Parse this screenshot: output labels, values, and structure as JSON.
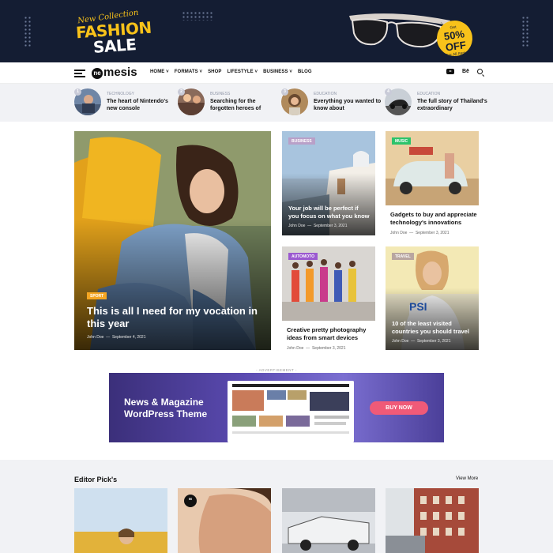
{
  "promo_banner": {
    "line1": "New Collection",
    "line2": "FASHION",
    "line3": "SALE",
    "tag_top": "Get",
    "tag_main": "50% OFF",
    "tag_bottom": "For All Items",
    "colors": {
      "background": "#141d33",
      "accent": "#f8c21a"
    }
  },
  "header": {
    "logo_mark": "ne",
    "logo_text": "mesis",
    "menu": [
      "HOME",
      "FORMATS",
      "SHOP",
      "LIFESTYLE",
      "BUSINESS",
      "BLOG"
    ],
    "menu_dropdown": [
      true,
      true,
      false,
      true,
      true,
      false
    ],
    "icons": [
      "menu-icon",
      "youtube-icon",
      "behance-icon",
      "search-icon"
    ],
    "behance_label": "Bē"
  },
  "trending": [
    {
      "num": "1",
      "category": "TECHNOLOGY",
      "title": "The heart of Nintendo's new console"
    },
    {
      "num": "2",
      "category": "BUSINESS",
      "title": "Searching for the forgotten heroes of"
    },
    {
      "num": "3",
      "category": "EDUCATION",
      "title": "Everything you wanted to know about"
    },
    {
      "num": "4",
      "category": "EDUCATION",
      "title": "The full story of Thailand's extraordinary"
    }
  ],
  "featured": {
    "category": "SPORT",
    "title": "This is all I need for my vocation in this year",
    "author": "John Doe",
    "date": "September 4, 2021"
  },
  "grid_posts": [
    {
      "category": "BUSINESS",
      "title": "Your job will be perfect if you focus on what you know",
      "author": "John Doe",
      "date": "September 3, 2021"
    },
    {
      "category": "MUSIC",
      "title": "Gadgets to buy and appreciate technology's innovations",
      "author": "John Doe",
      "date": "September 3, 2021"
    },
    {
      "category": "AUTOMOTO",
      "title": "Creative pretty photography ideas from smart devices",
      "author": "John Doe",
      "date": "September 3, 2021"
    },
    {
      "category": "TRAVEL",
      "title": "10 of the least visited countries you should travel",
      "author": "John Doe",
      "date": "September 3, 2021"
    }
  ],
  "badge_colors": {
    "SPORT": "#f5a623",
    "BUSINESS": "#b9a0c8",
    "MUSIC": "#2cc36b",
    "AUTOMOTO": "#9b59d0",
    "TRAVEL": "#b9a6a0"
  },
  "ad": {
    "label": "- ADVERTISEMENT -",
    "title": "News & Magazine WordPress Theme",
    "button": "BUY NOW"
  },
  "editor_pick": {
    "title": "Editor Pick's",
    "view_more": "View More",
    "quote_icon": "quote-icon"
  },
  "shirt_text": "PSI"
}
